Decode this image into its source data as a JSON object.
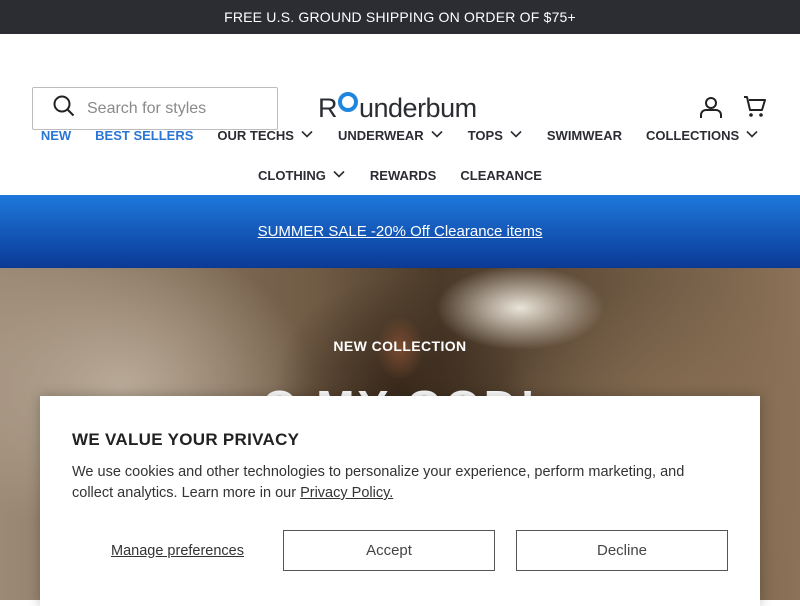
{
  "announcement": "FREE U.S. GROUND SHIPPING ON ORDER OF $75+",
  "search": {
    "placeholder": "Search for styles"
  },
  "logo": {
    "text_start": "R",
    "text_end": "underbum"
  },
  "nav": {
    "row1": [
      {
        "label": "NEW",
        "highlight": true,
        "dropdown": false
      },
      {
        "label": "BEST SELLERS",
        "highlight": true,
        "dropdown": false
      },
      {
        "label": "OUR TECHS",
        "highlight": false,
        "dropdown": true
      },
      {
        "label": "UNDERWEAR",
        "highlight": false,
        "dropdown": true
      },
      {
        "label": "TOPS",
        "highlight": false,
        "dropdown": true
      },
      {
        "label": "SWIMWEAR",
        "highlight": false,
        "dropdown": false
      },
      {
        "label": "COLLECTIONS",
        "highlight": false,
        "dropdown": true
      }
    ],
    "row2": [
      {
        "label": "CLOTHING",
        "highlight": false,
        "dropdown": true
      },
      {
        "label": "REWARDS",
        "highlight": false,
        "dropdown": false
      },
      {
        "label": "CLEARANCE",
        "highlight": false,
        "dropdown": false
      }
    ]
  },
  "promo": {
    "text": "SUMMER SALE -20% Off Clearance items"
  },
  "hero": {
    "label": "NEW COLLECTION",
    "title": "O MY GOD!"
  },
  "cookie": {
    "title": "WE VALUE YOUR PRIVACY",
    "body": "We use cookies and other technologies to personalize your experience, perform marketing, and collect analytics. Learn more in our ",
    "policy_link": "Privacy Policy.",
    "manage": "Manage preferences",
    "accept": "Accept",
    "decline": "Decline"
  },
  "colors": {
    "accent": "#2b76d4",
    "logo_ring": "#1f86e0",
    "topbar": "#2b2d33",
    "promo_top": "#1e78dc",
    "promo_bottom": "#0b3a96"
  },
  "icons": [
    "search-icon",
    "account-icon",
    "cart-icon",
    "chevron-down-icon"
  ]
}
